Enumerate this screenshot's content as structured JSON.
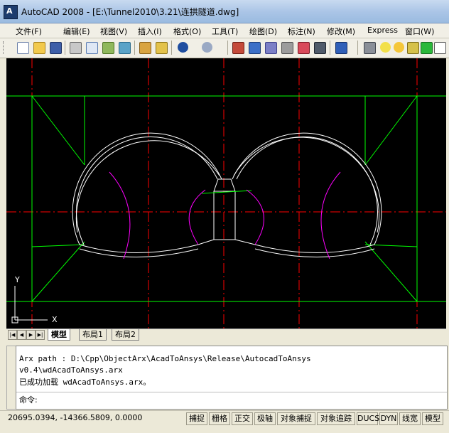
{
  "window": {
    "title": "AutoCAD 2008 - [E:\\Tunnel2010\\3.21\\连拱隧道.dwg]",
    "icon_letter": "A"
  },
  "menu": [
    "文件(F)",
    "编辑(E)",
    "视图(V)",
    "插入(I)",
    "格式(O)",
    "工具(T)",
    "绘图(D)",
    "标注(N)",
    "修改(M)",
    "Express",
    "窗口(W)"
  ],
  "toolbar": {
    "icons": [
      "new-icon",
      "open-icon",
      "save-icon",
      "print-icon",
      "preview-icon",
      "publish-icon",
      "plot-icon",
      "pencil-icon",
      "match-icon",
      "undo-icon",
      "redo-icon",
      "designcenter-icon",
      "properties-icon",
      "toolpalette-icon",
      "sheetset-icon",
      "markup-icon",
      "calculator-icon",
      "help-icon",
      "layers-icon",
      "bulb-icon",
      "sun-icon",
      "lock-icon",
      "color-icon",
      "layer-state-icon"
    ]
  },
  "drawing": {
    "colors": {
      "bg": "#000000",
      "lining": "#ffffff",
      "support": "#00ff00",
      "arc": "#ff00ff",
      "centerline": "#ff0000"
    },
    "ucs": {
      "x_label": "X",
      "y_label": "Y"
    }
  },
  "layout_tabs": [
    "模型",
    "布局1",
    "布局2"
  ],
  "command": {
    "history": [
      " Arx path : D:\\Cpp\\ObjectArx\\AcadToAnsys\\Release\\AutocadToAnsys",
      "v0.4\\wdAcadToAnsys.arx",
      "已成功加载 wdAcadToAnsys.arx。"
    ],
    "prompt": "命令:"
  },
  "status": {
    "coords": "20695.0394, -14366.5809, 0.0000",
    "buttons": [
      "捕捉",
      "栅格",
      "正交",
      "极轴",
      "对象捕捉",
      "对象追踪",
      "DUCS",
      "DYN",
      "线宽",
      "模型"
    ]
  }
}
